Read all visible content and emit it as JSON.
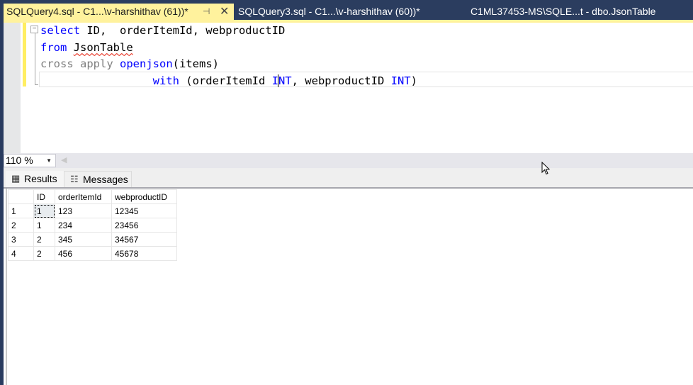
{
  "tabs": [
    {
      "label": "SQLQuery4.sql - C1...\\v-harshithav (61))*",
      "active": true,
      "pin_icon": "pin-icon",
      "close_icon": "close-icon"
    },
    {
      "label": "SQLQuery3.sql - C1...\\v-harshithav (60))*",
      "active": false
    },
    {
      "label": "C1ML37453-MS\\SQLE...t - dbo.JsonTable",
      "active": false
    }
  ],
  "editor": {
    "lines": [
      {
        "parts": [
          {
            "t": "select",
            "c": "kw"
          },
          {
            "t": " ID,  orderItemId, webproductID",
            "c": ""
          }
        ]
      },
      {
        "parts": [
          {
            "t": "from",
            "c": "kw"
          },
          {
            "t": " ",
            "c": ""
          },
          {
            "t": "JsonTable",
            "c": "squiggle"
          }
        ]
      },
      {
        "parts": [
          {
            "t": "cross apply",
            "c": "gray"
          },
          {
            "t": " ",
            "c": ""
          },
          {
            "t": "openjson",
            "c": "kw"
          },
          {
            "t": "(items)",
            "c": ""
          }
        ]
      },
      {
        "parts": [
          {
            "t": "                 ",
            "c": ""
          },
          {
            "t": "with",
            "c": "kw"
          },
          {
            "t": " (orderItemId ",
            "c": ""
          },
          {
            "t": "I",
            "c": "kw"
          },
          {
            "t": "CARET",
            "c": "caret"
          },
          {
            "t": "NT",
            "c": "kw"
          },
          {
            "t": ", webproductID ",
            "c": ""
          },
          {
            "t": "INT",
            "c": "kw"
          },
          {
            "t": ")",
            "c": ""
          }
        ]
      }
    ]
  },
  "zoom": {
    "value": "110 %"
  },
  "results_tabs": [
    {
      "label": "Results",
      "icon": "grid-icon"
    },
    {
      "label": "Messages",
      "icon": "messages-icon"
    }
  ],
  "grid": {
    "columns": [
      "",
      "ID",
      "orderItemId",
      "webproductID"
    ],
    "rows": [
      [
        "1",
        "1",
        "123",
        "12345"
      ],
      [
        "2",
        "1",
        "234",
        "23456"
      ],
      [
        "3",
        "2",
        "345",
        "34567"
      ],
      [
        "4",
        "2",
        "456",
        "45678"
      ]
    ]
  },
  "colors": {
    "active_tab": "#fff29d",
    "tab_bar": "#2b3d5f",
    "keyword": "#0000ff",
    "comment_gray": "#808080"
  }
}
